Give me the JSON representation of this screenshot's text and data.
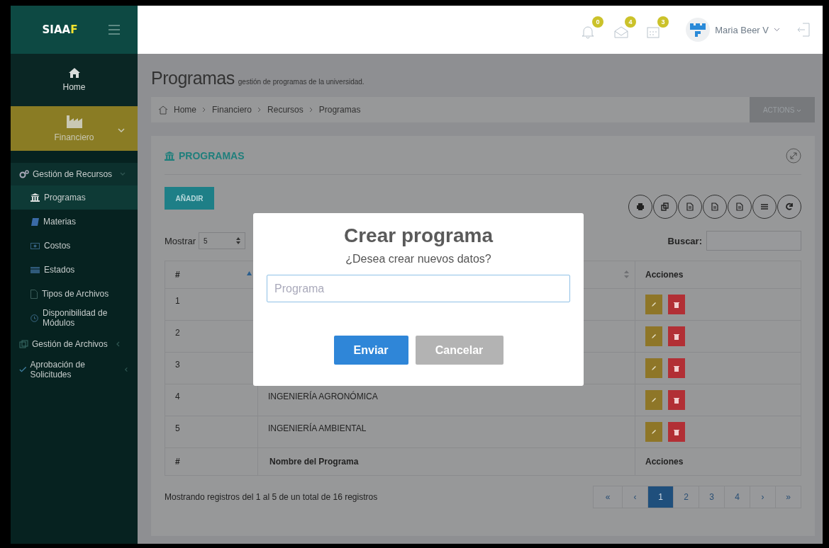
{
  "brand": {
    "text": "SIAA",
    "accent": "F"
  },
  "header": {
    "notifications": [
      {
        "count": "0"
      },
      {
        "count": "4"
      },
      {
        "count": "3"
      }
    ],
    "user": "Maria Beer V"
  },
  "sidebar": {
    "items": [
      {
        "label": "Home",
        "selected": false
      },
      {
        "label": "Financiero",
        "selected": true,
        "expanded": true
      },
      {
        "label": "Gestión de Recursos",
        "expanded": true,
        "children": [
          {
            "label": "Programas",
            "selected": true
          },
          {
            "label": "Materias",
            "selected": false
          },
          {
            "label": "Costos",
            "selected": false
          },
          {
            "label": "Estados",
            "selected": false
          },
          {
            "label": "Tipos de Archivos",
            "selected": false
          },
          {
            "label": "Disponibilidad de Módulos",
            "selected": false
          }
        ]
      },
      {
        "label": "Gestión de Archivos",
        "expanded": false
      },
      {
        "label": "Aprobación de Solicitudes",
        "expanded": false
      }
    ]
  },
  "page": {
    "title": "Programas",
    "subtitle": "gestión de programas de la universidad."
  },
  "breadcrumb": [
    "Home",
    "Financiero",
    "Recursos",
    "Programas"
  ],
  "actions_button": "ACTIONS",
  "card": {
    "title": "PROGRAMAS",
    "add_button": "AÑADIR",
    "length": {
      "label": "Mostrar",
      "value": "5"
    },
    "search": {
      "label": "Buscar:"
    },
    "table": {
      "header": [
        {
          "label": "#",
          "kind": "ascending"
        },
        {
          "kind": "sortable"
        },
        {
          "label": "Acciones",
          "kind": "plain"
        }
      ],
      "rows": [
        {
          "number": "1"
        },
        {
          "number": "2"
        },
        {
          "number": "3"
        },
        {
          "number": "4",
          "name": "INGENIERÍA AGRONÓMICA"
        },
        {
          "number": "5",
          "name": "INGENIERÍA AMBIENTAL"
        }
      ],
      "footer": [
        "#",
        "Nombre del Programa",
        "Acciones"
      ]
    },
    "info": "Mostrando registros del 1 al 5 de un total de 16 registros",
    "pagination": [
      {
        "label": "«",
        "selected": false
      },
      {
        "label": "‹",
        "selected": false
      },
      {
        "label": "1",
        "selected": true
      },
      {
        "label": "2",
        "selected": false
      },
      {
        "label": "3",
        "selected": false
      },
      {
        "label": "4",
        "selected": false
      },
      {
        "label": "›",
        "selected": false
      },
      {
        "label": "»",
        "selected": false
      }
    ]
  },
  "modal": {
    "title": "Crear programa",
    "text": "¿Desea crear nuevos datos?",
    "placeholder": "Programa",
    "buttons": [
      {
        "label": "Enviar",
        "kind": "primary"
      },
      {
        "label": "Cancelar",
        "kind": "secondary"
      }
    ]
  }
}
